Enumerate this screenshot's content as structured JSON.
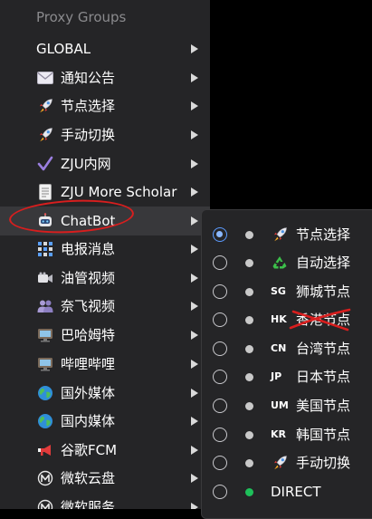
{
  "menu": {
    "header": "Proxy Groups",
    "items": [
      {
        "label": "GLOBAL",
        "icon": ""
      },
      {
        "label": "通知公告",
        "icon": "envelope-icon"
      },
      {
        "label": "节点选择",
        "icon": "rocket-icon"
      },
      {
        "label": "手动切换",
        "icon": "rocket-icon"
      },
      {
        "label": "ZJU内网",
        "icon": "checkmark-icon"
      },
      {
        "label": "ZJU More Scholar",
        "icon": "document-icon"
      },
      {
        "label": "ChatBot",
        "icon": "robot-icon"
      },
      {
        "label": "电报消息",
        "icon": "chat-grid-icon"
      },
      {
        "label": "油管视频",
        "icon": "video-camera-icon"
      },
      {
        "label": "奈飞视频",
        "icon": "people-icon"
      },
      {
        "label": "巴哈姆特",
        "icon": "tv-icon"
      },
      {
        "label": "哔哩哔哩",
        "icon": "tv-icon"
      },
      {
        "label": "国外媒体",
        "icon": "globe-icon"
      },
      {
        "label": "国内媒体",
        "icon": "globe-icon"
      },
      {
        "label": "谷歌FCM",
        "icon": "megaphone-icon"
      },
      {
        "label": "微软云盘",
        "icon": "ms-icon"
      },
      {
        "label": "微软服务",
        "icon": "ms-icon"
      }
    ]
  },
  "submenu": {
    "items": [
      {
        "code": "",
        "label": "节点选择",
        "icon": "rocket-icon",
        "selected": true
      },
      {
        "code": "",
        "label": "自动选择",
        "icon": "recycle-icon",
        "selected": false
      },
      {
        "code": "SG",
        "label": "狮城节点",
        "icon": "",
        "selected": false
      },
      {
        "code": "HK",
        "label": "香港节点",
        "icon": "",
        "selected": false
      },
      {
        "code": "CN",
        "label": "台湾节点",
        "icon": "",
        "selected": false
      },
      {
        "code": "JP",
        "label": "日本节点",
        "icon": "",
        "selected": false
      },
      {
        "code": "UM",
        "label": "美国节点",
        "icon": "",
        "selected": false
      },
      {
        "code": "KR",
        "label": "韩国节点",
        "icon": "",
        "selected": false
      },
      {
        "code": "",
        "label": "手动切换",
        "icon": "rocket-icon",
        "selected": false
      },
      {
        "code": "",
        "label": "DIRECT",
        "icon": "",
        "selected": false
      }
    ]
  },
  "colors": {
    "menu_bg": "#252527",
    "highlight_bg": "#38383b",
    "radio_selected": "#5b9bff",
    "direct_dot": "#1ec05a",
    "annotation": "#d81e1e"
  }
}
